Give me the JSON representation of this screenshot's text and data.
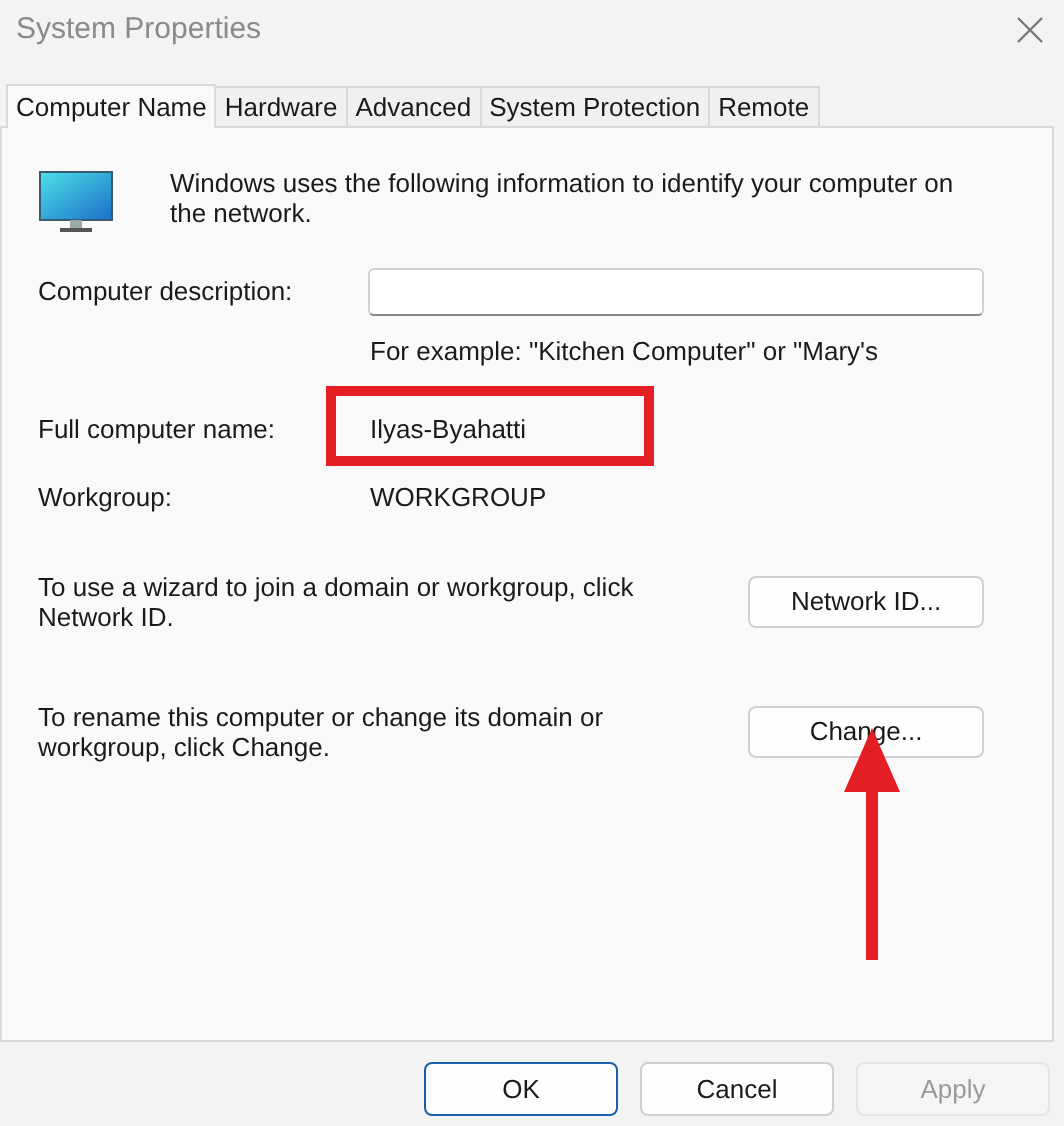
{
  "window": {
    "title": "System Properties"
  },
  "tabs": [
    {
      "label": "Computer Name",
      "selected": true
    },
    {
      "label": "Hardware",
      "selected": false
    },
    {
      "label": "Advanced",
      "selected": false
    },
    {
      "label": "System Protection",
      "selected": false
    },
    {
      "label": "Remote",
      "selected": false
    }
  ],
  "intro": "Windows uses the following information to identify your computer on the network.",
  "description": {
    "label": "Computer description:",
    "hint": "For example: \"Kitchen Computer\" or \"Mary's"
  },
  "full_name": {
    "label": "Full computer name:",
    "value": "Ilyas-Byahatti"
  },
  "workgroup": {
    "label": "Workgroup:",
    "value": "WORKGROUP"
  },
  "actions": [
    {
      "text": "To use a wizard to join a domain or workgroup, click Network ID.",
      "button": "Network ID..."
    },
    {
      "text": "To rename this computer or change its domain or workgroup, click Change.",
      "button": "Change..."
    }
  ],
  "buttons": [
    {
      "label": "OK",
      "default": true,
      "disabled": false
    },
    {
      "label": "Cancel",
      "default": false,
      "disabled": false
    },
    {
      "label": "Apply",
      "default": false,
      "disabled": true
    }
  ],
  "annotations": {
    "highlight_box": true,
    "arrow": true
  }
}
